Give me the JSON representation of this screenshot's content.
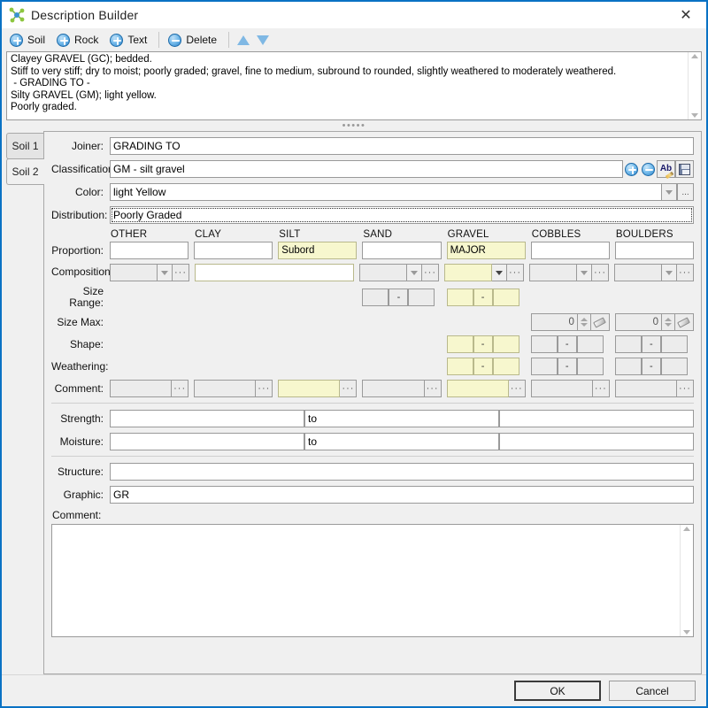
{
  "window": {
    "title": "Description Builder",
    "icon": "molecule-icon",
    "close_label": "✕",
    "border_color": "#0a72c4"
  },
  "toolbar": {
    "items": [
      {
        "label": "Soil",
        "icon": "plus-circle-icon"
      },
      {
        "label": "Rock",
        "icon": "plus-circle-icon"
      },
      {
        "label": "Text",
        "icon": "plus-circle-icon"
      },
      {
        "label": "Delete",
        "icon": "minus-circle-icon"
      }
    ],
    "move_up": "move-up-icon",
    "move_down": "move-down-icon"
  },
  "description": {
    "text": "Clayey GRAVEL (GC); bedded.\nStiff to very stiff; dry to moist; poorly graded; gravel, fine to medium, subround to rounded, slightly weathered to moderately weathered.\n - GRADING TO -\nSilty GRAVEL (GM); light yellow.\nPoorly graded.",
    "splitter_glyph": "•••••"
  },
  "tabs": [
    {
      "label": "Soil 1",
      "active": false
    },
    {
      "label": "Soil 2",
      "active": true
    }
  ],
  "form": {
    "joiner": {
      "label": "Joiner:",
      "value": "GRADING TO"
    },
    "classification": {
      "label": "Classification:",
      "value": "GM - silt gravel",
      "buttons": [
        "add-icon",
        "remove-icon",
        "rename-icon",
        "save-icon"
      ]
    },
    "color": {
      "label": "Color:",
      "value": "light Yellow",
      "dropdown": "chevron-down-icon",
      "ellipsis": "..."
    },
    "distribution": {
      "label": "Distribution:",
      "value": "Poorly Graded",
      "focused": true
    },
    "proportion_label": "Proportion:",
    "composition_label": "Composition:",
    "size_range_label": "Size Range:",
    "size_max_label": "Size Max:",
    "shape_label": "Shape:",
    "weathering_label": "Weathering:",
    "comment_row_label": "Comment:",
    "columns": [
      "OTHER",
      "CLAY",
      "SILT",
      "SAND",
      "GRAVEL",
      "COBBLES",
      "BOULDERS"
    ],
    "proportion_values": [
      "",
      "",
      "Subord",
      "",
      "MAJOR",
      "",
      ""
    ],
    "proportion_highlight": [
      false,
      false,
      true,
      false,
      true,
      false,
      false
    ],
    "composition_values": [
      "",
      "",
      "",
      "",
      "",
      "",
      ""
    ],
    "composition_highlight": [
      false,
      true,
      true,
      false,
      true,
      false,
      false
    ],
    "size_max_values": [
      "0",
      "0"
    ],
    "strength": {
      "label": "Strength:",
      "value": "",
      "joiner": "to",
      "value2": ""
    },
    "moisture": {
      "label": "Moisture:",
      "value": "",
      "joiner": "to",
      "value2": ""
    },
    "structure": {
      "label": "Structure:",
      "value": ""
    },
    "graphic": {
      "label": "Graphic:",
      "value": "GR"
    },
    "comment": {
      "label": "Comment:",
      "value": ""
    }
  },
  "footer": {
    "ok_label": "OK",
    "cancel_label": "Cancel"
  },
  "colors": {
    "highlight_yellow": "#f7f7ce",
    "window_border": "#0a72c4",
    "panel_bg": "#f0f0f0"
  }
}
